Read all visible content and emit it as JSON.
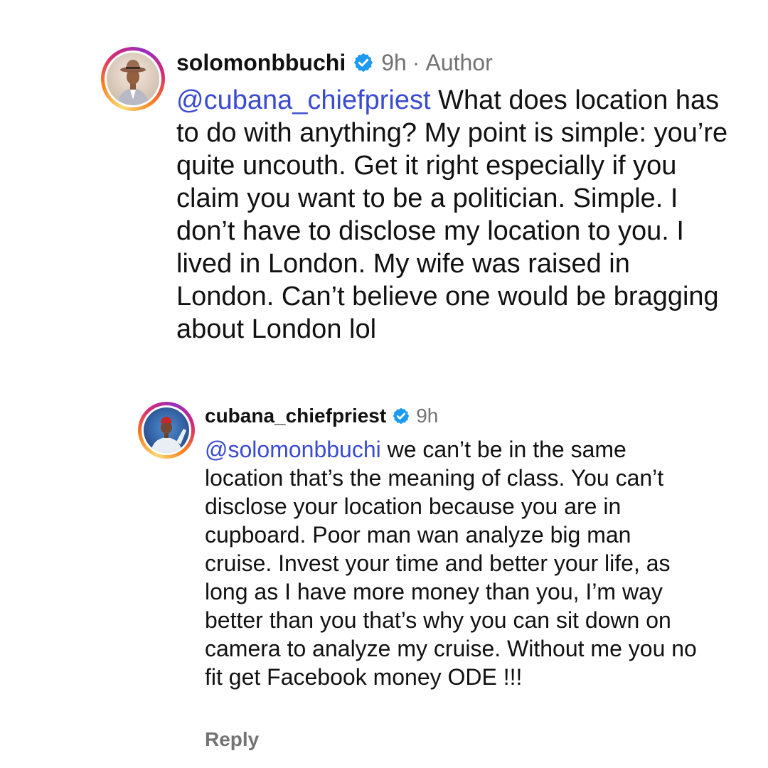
{
  "thread": {
    "parent": {
      "username": "solomonbbuchi",
      "verified": true,
      "time": "9h",
      "separator": "·",
      "author_tag": "Author",
      "mention": "@cubana_chiefpriest",
      "text": "What does location has to do with anything? My point is simple: you’re quite uncouth. Get it right especially if you claim you want to be a politician. Simple. I don’t have to disclose my location to you. I lived in London. My wife was raised in London. Can’t believe one would be bragging about London lol",
      "avatar_icon": "profile-photo-man-in-hat"
    },
    "reply": {
      "username": "cubana_chiefpriest",
      "verified": true,
      "time": "9h",
      "mention": "@solomonbbuchi",
      "text": "we can’t be in the same location that’s the meaning of class. You can’t disclose your location because you are in cupboard. Poor man wan analyze big man cruise. Invest your time and better your life, as long as I have more money than you, I’m way better than you that’s why you can sit down on camera to analyze my cruise. Without me you no fit get Facebook money ODE !!!",
      "reply_label": "Reply",
      "avatar_icon": "profile-photo-man-in-red-cap"
    }
  },
  "colors": {
    "mention": "#3b4bd1",
    "meta": "#737373",
    "verified_badge": "#1d9bf0"
  }
}
